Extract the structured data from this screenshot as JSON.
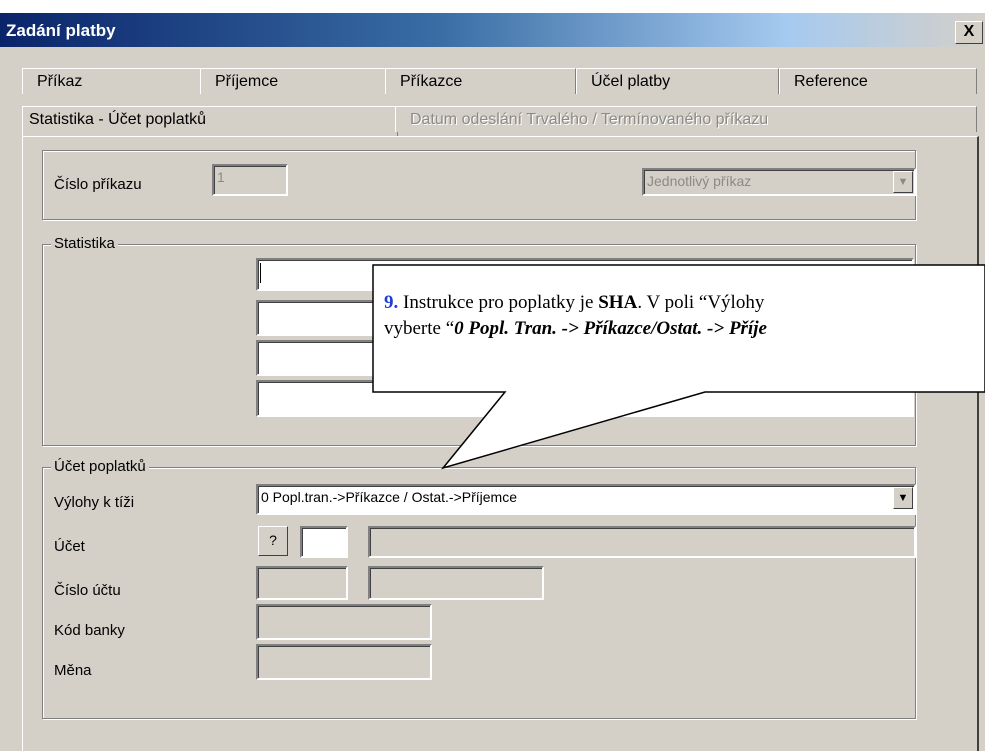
{
  "window": {
    "title": "Zadání platby",
    "close_label": "X"
  },
  "tabs": {
    "row1": [
      {
        "label": "Příkaz"
      },
      {
        "label": "Příjemce"
      },
      {
        "label": "Příkazce"
      },
      {
        "label": "Účel platby"
      },
      {
        "label": "Reference"
      }
    ],
    "row2": [
      {
        "label": "Statistika - Účet poplatků",
        "state": "active"
      },
      {
        "label": "Datum odeslání Trvalého / Termínovaného příkazu",
        "state": "disabled"
      }
    ]
  },
  "order_group": {
    "order_number_label": "Číslo příkazu",
    "order_number_value": "1",
    "order_type_value": "Jednotlivý příkaz"
  },
  "statistics_group": {
    "legend": "Statistika"
  },
  "fees_group": {
    "legend": "Účet poplatků",
    "charges_label": "Výlohy k tíži",
    "charges_value": "0 Popl.tran.->Příkazce / Ostat.->Příjemce",
    "account_label": "Účet",
    "account_lookup_label": "?",
    "account_number_label": "Číslo účtu",
    "bank_code_label": "Kód banky",
    "currency_label": "Měna"
  },
  "callout": {
    "number": "9.",
    "line1_a": " Instrukce pro poplatky je ",
    "line1_b": "SHA",
    "line1_c": ".  V poli “Výlohy",
    "line2_a": "vyberte  “",
    "line2_b": "0 Popl. Tran. -> Příkazce/Ostat. -> Příje"
  }
}
